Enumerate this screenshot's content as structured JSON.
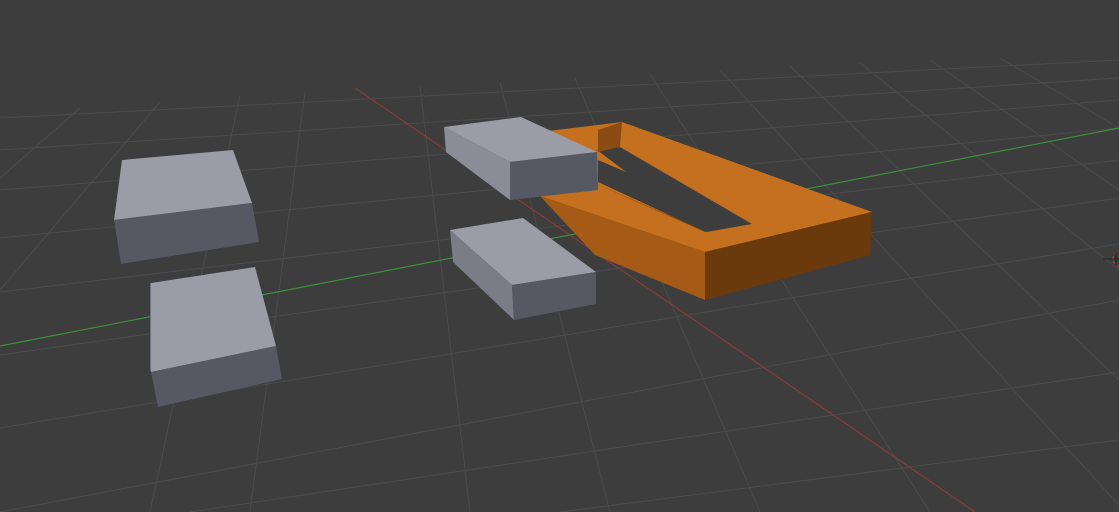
{
  "viewport": {
    "background_color": "#3d3d3d",
    "grid_color": "#4b4b4b",
    "x_axis_color": "#8a3a3a",
    "y_axis_color": "#3f8f3f",
    "cursor_icon": "3d-cursor-icon"
  },
  "objects": [
    {
      "name": "cube-1",
      "color": "#7c7e8c",
      "selected": false
    },
    {
      "name": "cube-2",
      "color": "#7c7e8c",
      "selected": false
    },
    {
      "name": "cube-3",
      "color": "#7c7e8c",
      "selected": false
    },
    {
      "name": "cube-4",
      "color": "#7c7e8c",
      "selected": false
    },
    {
      "name": "frame",
      "color": "#c66f1c",
      "selected": true
    }
  ]
}
